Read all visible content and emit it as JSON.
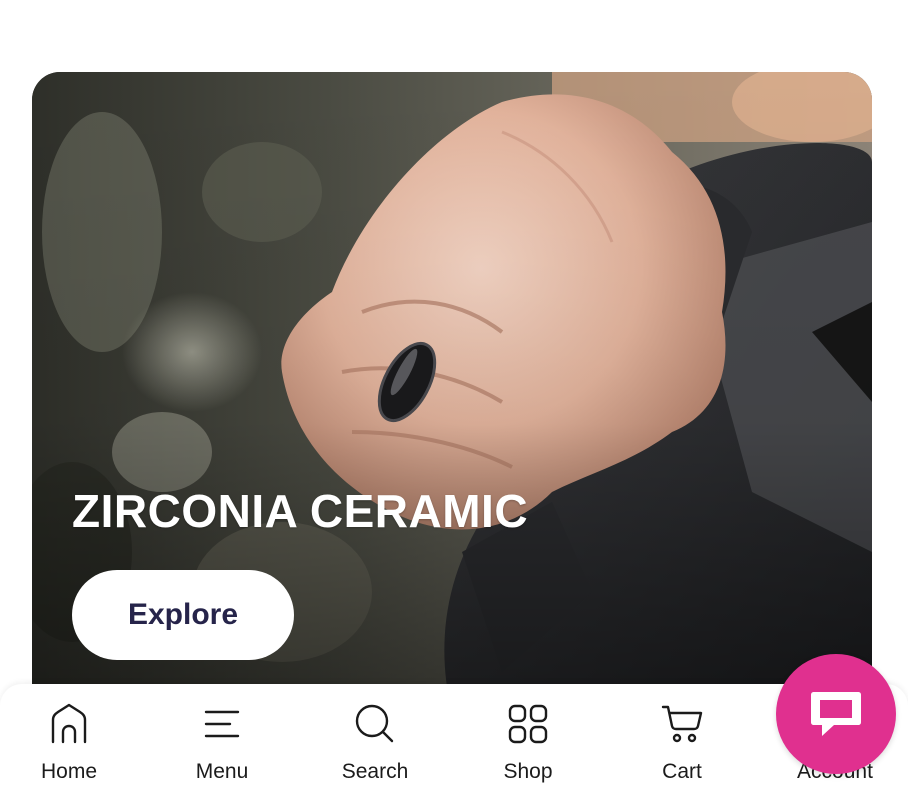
{
  "hero": {
    "title": "ZIRCONIA CERAMIC",
    "button_label": "Explore",
    "image_subject": "hand-wearing-ring-holding-weight-plate",
    "title_color": "#ffffff",
    "button_text_color": "#26244a"
  },
  "bottom_nav": {
    "items": [
      {
        "label": "Home",
        "icon": "home-icon"
      },
      {
        "label": "Menu",
        "icon": "menu-icon"
      },
      {
        "label": "Search",
        "icon": "search-icon"
      },
      {
        "label": "Shop",
        "icon": "grid-icon"
      },
      {
        "label": "Cart",
        "icon": "cart-icon"
      },
      {
        "label": "Account",
        "icon": "account-icon"
      }
    ]
  },
  "chat": {
    "icon": "chat-bubble-icon",
    "color": "#e0308f"
  }
}
